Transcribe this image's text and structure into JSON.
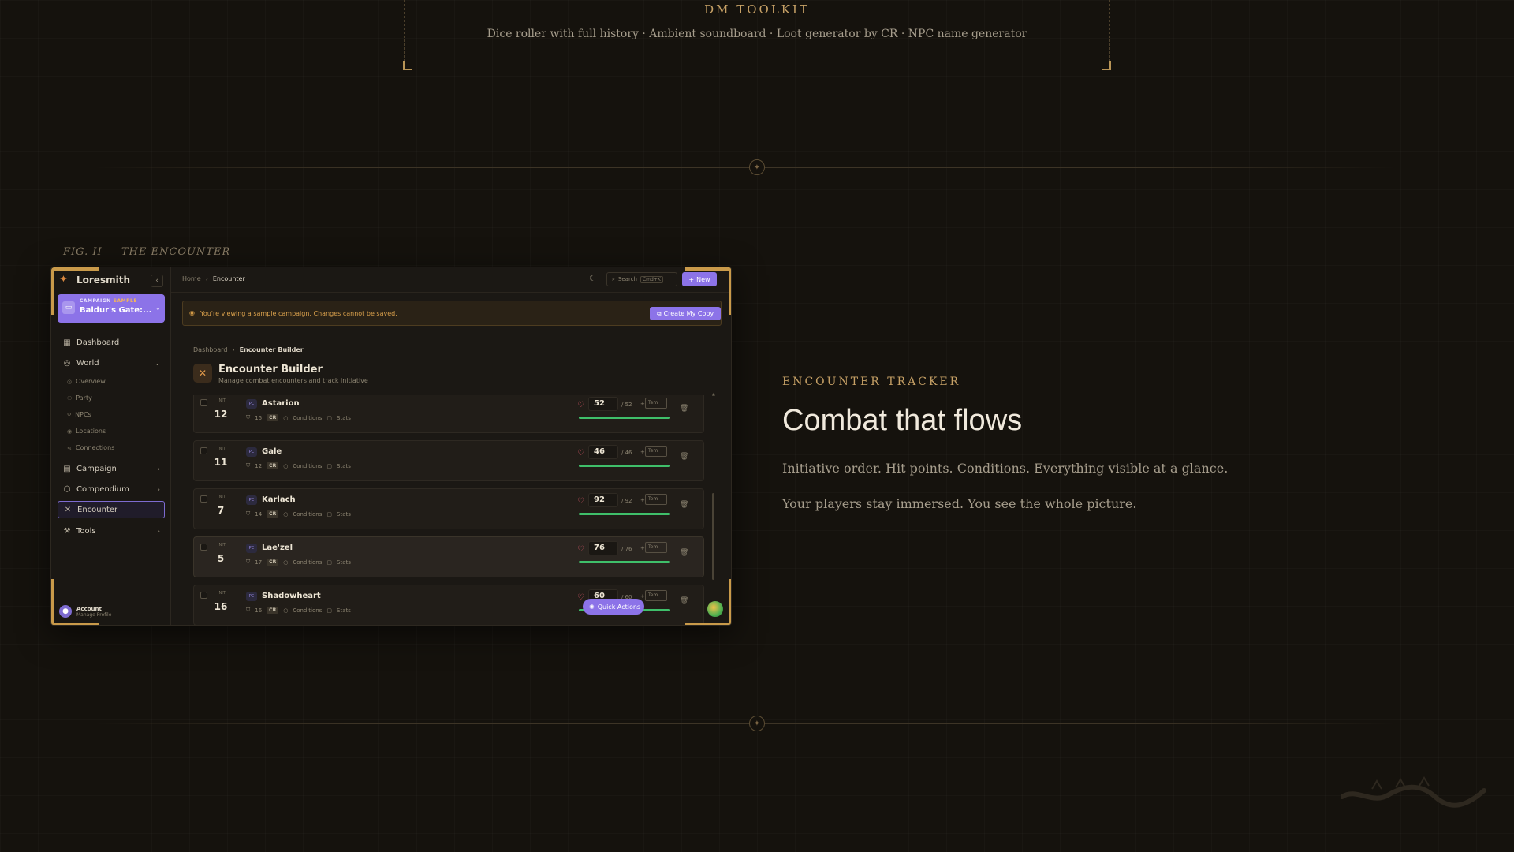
{
  "toolkit": {
    "title": "DM TOOLKIT",
    "description": "Dice roller with full history · Ambient soundboard · Loot generator by CR · NPC name generator"
  },
  "figure_caption": "FIG. II — THE ENCOUNTER",
  "app": {
    "brand": "Loresmith",
    "campaign": {
      "label": "CAMPAIGN",
      "badge": "SAMPLE",
      "name": "Baldur's Gate:..."
    },
    "nav": {
      "dashboard": "Dashboard",
      "world": "World",
      "world_sub": [
        "Overview",
        "Party",
        "NPCs",
        "Locations",
        "Connections"
      ],
      "campaign": "Campaign",
      "compendium": "Compendium",
      "encounter": "Encounter",
      "tools": "Tools"
    },
    "account": {
      "name": "Account",
      "sub": "Manage Profile"
    },
    "topbar": {
      "crumb_home": "Home",
      "crumb_current": "Encounter",
      "search_placeholder": "Search",
      "search_kbd": "Cmd+K",
      "new_label": "New"
    },
    "banner": {
      "text": "You're viewing a sample campaign. Changes cannot be saved.",
      "button": "Create My Copy"
    },
    "page": {
      "crumb_parent": "Dashboard",
      "crumb_current": "Encounter Builder",
      "title": "Encounter Builder",
      "subtitle": "Manage combat encounters and track initiative"
    },
    "row_labels": {
      "init": "INIT",
      "tag": "PC",
      "cr": "CR",
      "conditions": "Conditions",
      "stats": "Stats",
      "temp": "Tem"
    },
    "combatants": [
      {
        "name": "Astarion",
        "init": "12",
        "ac": "15",
        "hp": "52",
        "max": "/ 52",
        "fill": 1.0
      },
      {
        "name": "Gale",
        "init": "11",
        "ac": "12",
        "hp": "46",
        "max": "/ 46",
        "fill": 1.0
      },
      {
        "name": "Karlach",
        "init": "7",
        "ac": "14",
        "hp": "92",
        "max": "/ 92",
        "fill": 1.0
      },
      {
        "name": "Lae'zel",
        "init": "5",
        "ac": "17",
        "hp": "76",
        "max": "/ 76",
        "fill": 1.0
      },
      {
        "name": "Shadowheart",
        "init": "16",
        "ac": "16",
        "hp": "60",
        "max": "/ 60",
        "fill": 1.0
      }
    ],
    "quick_actions": "Quick Actions"
  },
  "feature": {
    "eyebrow": "ENCOUNTER TRACKER",
    "headline": "Combat that flows",
    "para1": "Initiative order. Hit points. Conditions. Everything visible at a glance.",
    "para2": "Your players stay immersed. You see the whole picture."
  },
  "colors": {
    "accent": "#8c73e8",
    "gold": "#c7a166",
    "hp_green": "#3fbf6a",
    "heart": "#e05a6b"
  }
}
